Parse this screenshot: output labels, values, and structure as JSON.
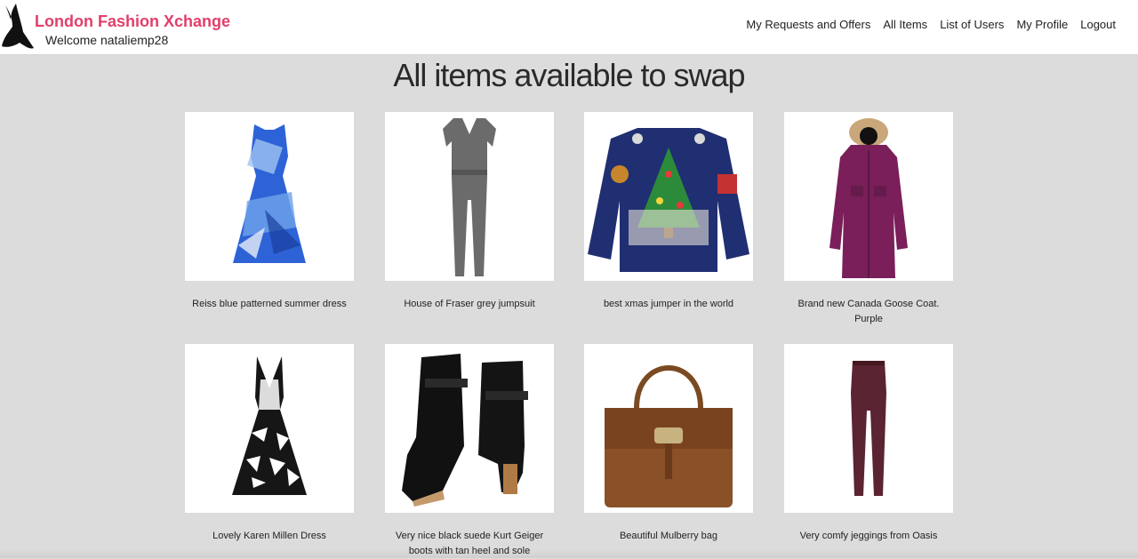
{
  "header": {
    "brand": "London Fashion Xchange",
    "welcome": "Welcome nataliemp28",
    "brand_color": "#e23e6b"
  },
  "nav": [
    {
      "label": "My Requests and Offers"
    },
    {
      "label": "All Items"
    },
    {
      "label": "List of Users"
    },
    {
      "label": "My Profile"
    },
    {
      "label": "Logout"
    }
  ],
  "page": {
    "title": "All items available to swap"
  },
  "items": [
    {
      "caption": "Reiss blue patterned summer dress",
      "icon": "blue-dress-image"
    },
    {
      "caption": "House of Fraser grey jumpsuit",
      "icon": "grey-jumpsuit-image"
    },
    {
      "caption": "best xmas jumper in the world",
      "icon": "xmas-jumper-image"
    },
    {
      "caption": "Brand new Canada Goose Coat. Purple",
      "icon": "purple-coat-image"
    },
    {
      "caption": "Lovely Karen Millen Dress",
      "icon": "black-white-dress-image"
    },
    {
      "caption": "Very nice black suede Kurt Geiger boots with tan heel and sole",
      "icon": "black-boots-image"
    },
    {
      "caption": "Beautiful Mulberry bag",
      "icon": "brown-bag-image"
    },
    {
      "caption": "Very comfy jeggings from Oasis",
      "icon": "jeggings-image"
    }
  ]
}
